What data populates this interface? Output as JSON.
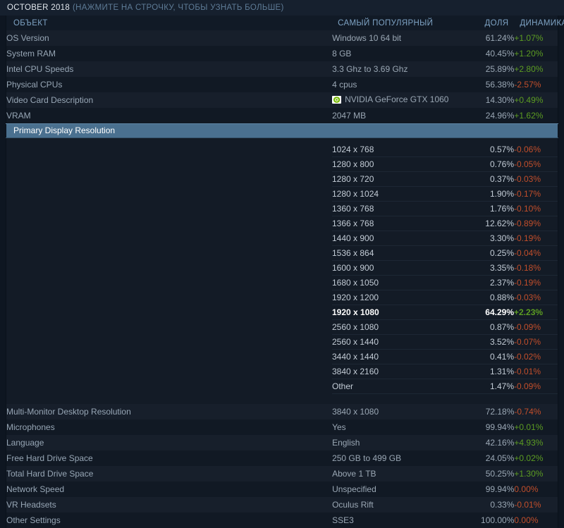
{
  "header": {
    "title": "OCTOBER 2018",
    "subtitle": "(НАЖМИТЕ НА СТРОЧКУ, ЧТОБЫ УЗНАТЬ БОЛЬШЕ)"
  },
  "columns": {
    "object": "ОБЪЕКТ",
    "popular": "САМЫЙ ПОПУЛЯРНЫЙ",
    "share": "ДОЛЯ",
    "change": "ДИНАМИКА"
  },
  "colors": {
    "up": "#5c9c22",
    "down": "#c14e2b",
    "selected_row": "#4a708f",
    "row_odd": "#171f2b",
    "row_even": "#111924",
    "page_bg": "#0e1621"
  },
  "rows_top": [
    {
      "object": "OS Version",
      "popular": "Windows 10 64 bit",
      "share": "61.24%",
      "change": "+1.07%",
      "dir": "up",
      "icon": null
    },
    {
      "object": "System RAM",
      "popular": "8 GB",
      "share": "40.45%",
      "change": "+1.20%",
      "dir": "up",
      "icon": null
    },
    {
      "object": "Intel CPU Speeds",
      "popular": "3.3 Ghz to 3.69 Ghz",
      "share": "25.89%",
      "change": "+2.80%",
      "dir": "up",
      "icon": null
    },
    {
      "object": "Physical CPUs",
      "popular": "4 cpus",
      "share": "56.38%",
      "change": "-2.57%",
      "dir": "down",
      "icon": null
    },
    {
      "object": "Video Card Description",
      "popular": "NVIDIA GeForce GTX 1060",
      "share": "14.30%",
      "change": "+0.49%",
      "dir": "up",
      "icon": "nvidia-logo-icon"
    },
    {
      "object": "VRAM",
      "popular": "2047 MB",
      "share": "24.96%",
      "change": "+1.62%",
      "dir": "up",
      "icon": null
    }
  ],
  "expanded": {
    "object": "Primary Display Resolution",
    "details": [
      {
        "name": "1024 x 768",
        "share": "0.57%",
        "change": "-0.06%",
        "dir": "down",
        "highlight": false
      },
      {
        "name": "1280 x 800",
        "share": "0.76%",
        "change": "-0.05%",
        "dir": "down",
        "highlight": false
      },
      {
        "name": "1280 x 720",
        "share": "0.37%",
        "change": "-0.03%",
        "dir": "down",
        "highlight": false
      },
      {
        "name": "1280 x 1024",
        "share": "1.90%",
        "change": "-0.17%",
        "dir": "down",
        "highlight": false
      },
      {
        "name": "1360 x 768",
        "share": "1.76%",
        "change": "-0.10%",
        "dir": "down",
        "highlight": false
      },
      {
        "name": "1366 x 768",
        "share": "12.62%",
        "change": "-0.89%",
        "dir": "down",
        "highlight": false
      },
      {
        "name": "1440 x 900",
        "share": "3.30%",
        "change": "-0.19%",
        "dir": "down",
        "highlight": false
      },
      {
        "name": "1536 x 864",
        "share": "0.25%",
        "change": "-0.04%",
        "dir": "down",
        "highlight": false
      },
      {
        "name": "1600 x 900",
        "share": "3.35%",
        "change": "-0.18%",
        "dir": "down",
        "highlight": false
      },
      {
        "name": "1680 x 1050",
        "share": "2.37%",
        "change": "-0.19%",
        "dir": "down",
        "highlight": false
      },
      {
        "name": "1920 x 1200",
        "share": "0.88%",
        "change": "-0.03%",
        "dir": "down",
        "highlight": false
      },
      {
        "name": "1920 x 1080",
        "share": "64.29%",
        "change": "+2.23%",
        "dir": "up",
        "highlight": true
      },
      {
        "name": "2560 x 1080",
        "share": "0.87%",
        "change": "-0.09%",
        "dir": "down",
        "highlight": false
      },
      {
        "name": "2560 x 1440",
        "share": "3.52%",
        "change": "-0.07%",
        "dir": "down",
        "highlight": false
      },
      {
        "name": "3440 x 1440",
        "share": "0.41%",
        "change": "-0.02%",
        "dir": "down",
        "highlight": false
      },
      {
        "name": "3840 x 2160",
        "share": "1.31%",
        "change": "-0.01%",
        "dir": "down",
        "highlight": false
      },
      {
        "name": "Other",
        "share": "1.47%",
        "change": "-0.09%",
        "dir": "down",
        "highlight": false
      }
    ]
  },
  "rows_bottom": [
    {
      "object": "Multi-Monitor Desktop Resolution",
      "popular": "3840 x 1080",
      "share": "72.18%",
      "change": "-0.74%",
      "dir": "down",
      "icon": null
    },
    {
      "object": "Microphones",
      "popular": "Yes",
      "share": "99.94%",
      "change": "+0.01%",
      "dir": "up",
      "icon": null
    },
    {
      "object": "Language",
      "popular": "English",
      "share": "42.16%",
      "change": "+4.93%",
      "dir": "up",
      "icon": null
    },
    {
      "object": "Free Hard Drive Space",
      "popular": "250 GB to 499 GB",
      "share": "24.05%",
      "change": "+0.02%",
      "dir": "up",
      "icon": null
    },
    {
      "object": "Total Hard Drive Space",
      "popular": "Above 1 TB",
      "share": "50.25%",
      "change": "+1.30%",
      "dir": "up",
      "icon": null
    },
    {
      "object": "Network Speed",
      "popular": "Unspecified",
      "share": "99.94%",
      "change": "0.00%",
      "dir": "flat",
      "icon": null
    },
    {
      "object": "VR Headsets",
      "popular": "Oculus Rift",
      "share": "0.33%",
      "change": "-0.01%",
      "dir": "down",
      "icon": null
    },
    {
      "object": "Other Settings",
      "popular": "SSE3",
      "share": "100.00%",
      "change": "0.00%",
      "dir": "flat",
      "icon": null
    }
  ]
}
